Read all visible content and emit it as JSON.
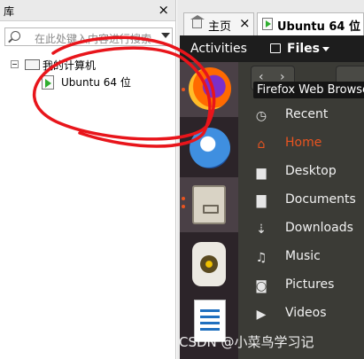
{
  "library": {
    "title": "库",
    "close_glyph": "×",
    "search_placeholder": "在此处键入内容进行搜索",
    "tree": {
      "root_label": "我的计算机",
      "vm_label": "Ubuntu 64 位"
    }
  },
  "tabs": [
    {
      "label": "主页",
      "close_glyph": "×"
    },
    {
      "label": "Ubuntu 64 位"
    }
  ],
  "ubuntu": {
    "activities": "Activities",
    "app_menu": "Files",
    "tooltip": "Firefox Web Browser",
    "nav": {
      "back": "‹",
      "forward": "›"
    },
    "dock": [
      {
        "icon": "firefox-icon"
      },
      {
        "icon": "thunderbird-icon"
      },
      {
        "icon": "files-icon"
      },
      {
        "icon": "rhythmbox-icon"
      },
      {
        "icon": "libreoffice-writer-icon"
      }
    ],
    "places": [
      {
        "label": "Recent",
        "icon": "clock-icon",
        "glyph": "◷"
      },
      {
        "label": "Home",
        "icon": "home-icon",
        "glyph": "⌂",
        "active": true
      },
      {
        "label": "Desktop",
        "icon": "folder-icon",
        "glyph": "▆"
      },
      {
        "label": "Documents",
        "icon": "document-icon",
        "glyph": "▇"
      },
      {
        "label": "Downloads",
        "icon": "download-icon",
        "glyph": "⇣"
      },
      {
        "label": "Music",
        "icon": "music-icon",
        "glyph": "♫"
      },
      {
        "label": "Pictures",
        "icon": "camera-icon",
        "glyph": "◙"
      },
      {
        "label": "Videos",
        "icon": "video-icon",
        "glyph": "▶"
      }
    ],
    "accent_color": "#e95420"
  },
  "watermark": "CSDN @小菜鸟学习记"
}
